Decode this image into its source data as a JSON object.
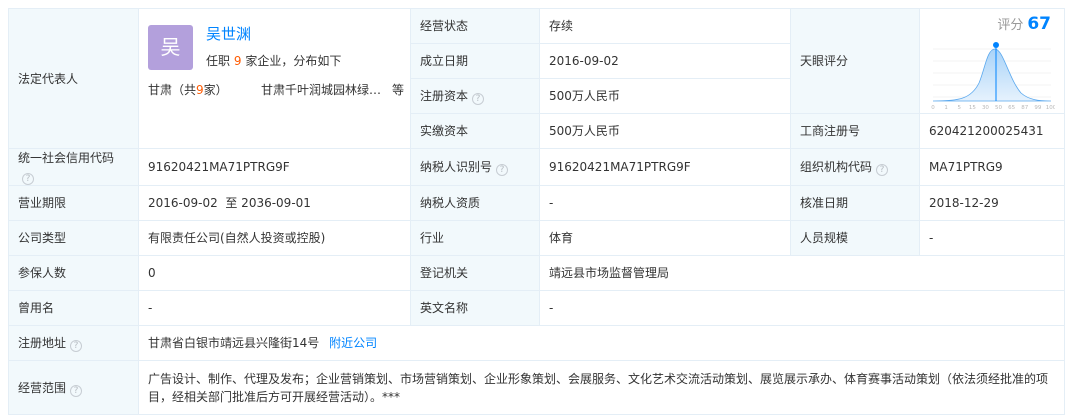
{
  "legal_rep": {
    "label": "法定代表人",
    "avatar_char": "吴",
    "name": "吴世渊",
    "sub_prefix": "任职",
    "sub_count": "9",
    "sub_suffix": "家企业，分布如下",
    "region_prefix": "甘肃（共",
    "region_count": "9",
    "region_suffix": "家）",
    "company": "甘肃千叶润城园林绿化工程有限公司",
    "more": "等"
  },
  "status": {
    "label": "经营状态",
    "value": "存续"
  },
  "founded": {
    "label": "成立日期",
    "value": "2016-09-02"
  },
  "reg_capital": {
    "label": "注册资本",
    "value": "500万人民币"
  },
  "paid_capital": {
    "label": "实缴资本",
    "value": "500万人民币"
  },
  "score": {
    "label": "天眼评分",
    "score_label": "评分",
    "score_value": "67",
    "ticks": [
      "0",
      "1",
      "5",
      "15",
      "30",
      "50",
      "65",
      "87",
      "99",
      "100"
    ],
    "marker_pct": 0.67
  },
  "biz_reg_no": {
    "label": "工商注册号",
    "value": "620421200025431"
  },
  "credit_code": {
    "label": "统一社会信用代码",
    "value": "91620421MA71PTRG9F"
  },
  "taxpayer_id": {
    "label": "纳税人识别号",
    "value": "91620421MA71PTRG9F"
  },
  "org_code": {
    "label": "组织机构代码",
    "value": "MA71PTRG9"
  },
  "term": {
    "label": "营业期限",
    "value": "2016-09-02  至 2036-09-01"
  },
  "tax_qual": {
    "label": "纳税人资质",
    "value": "-"
  },
  "approve_date": {
    "label": "核准日期",
    "value": "2018-12-29"
  },
  "company_type": {
    "label": "公司类型",
    "value": "有限责任公司(自然人投资或控股)"
  },
  "industry": {
    "label": "行业",
    "value": "体育"
  },
  "staff_size": {
    "label": "人员规模",
    "value": "-"
  },
  "insured": {
    "label": "参保人数",
    "value": "0"
  },
  "reg_authority": {
    "label": "登记机关",
    "value": "靖远县市场监督管理局"
  },
  "former_name": {
    "label": "曾用名",
    "value": "-"
  },
  "english_name": {
    "label": "英文名称",
    "value": "-"
  },
  "address": {
    "label": "注册地址",
    "value": "甘肃省白银市靖远县兴隆街14号",
    "link": "附近公司"
  },
  "scope": {
    "label": "经营范围",
    "value": "广告设计、制作、代理及发布；企业营销策划、市场营销策划、企业形象策划、会展服务、文化艺术交流活动策划、展览展示承办、体育赛事活动策划（依法须经批准的项目，经相关部门批准后方可开展经营活动）。***"
  },
  "colors": {
    "accent": "#0084ff",
    "label_bg": "#f2f9fc",
    "border": "#e4eef6",
    "avatar": "#b3a0dc",
    "highlight": "#ff5a00"
  }
}
